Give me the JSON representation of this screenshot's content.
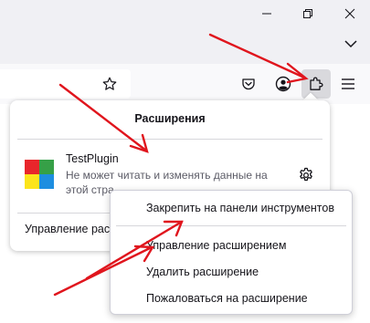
{
  "extensions_panel": {
    "title": "Расширения",
    "extension": {
      "name": "TestPlugin",
      "description_line1": "Не может читать и изменять данные на",
      "description_line2": "этой стра"
    },
    "manage_label": "Управление расш"
  },
  "context_menu": {
    "items": [
      "Закрепить на панели инструментов",
      "Управление расширением",
      "Удалить расширение",
      "Пожаловаться на расширение"
    ]
  },
  "icons": {
    "window": [
      "minimize-icon",
      "restore-icon",
      "close-icon"
    ],
    "toolbar": [
      "bookmark-star-icon",
      "pocket-icon",
      "account-icon",
      "extensions-puzzle-icon",
      "hamburger-menu-icon"
    ],
    "extension_logo_colors": [
      "#e8262b",
      "#36a047",
      "#fce41b",
      "#1e8ee0"
    ],
    "annotation_arrow_color": "#e0151d"
  }
}
